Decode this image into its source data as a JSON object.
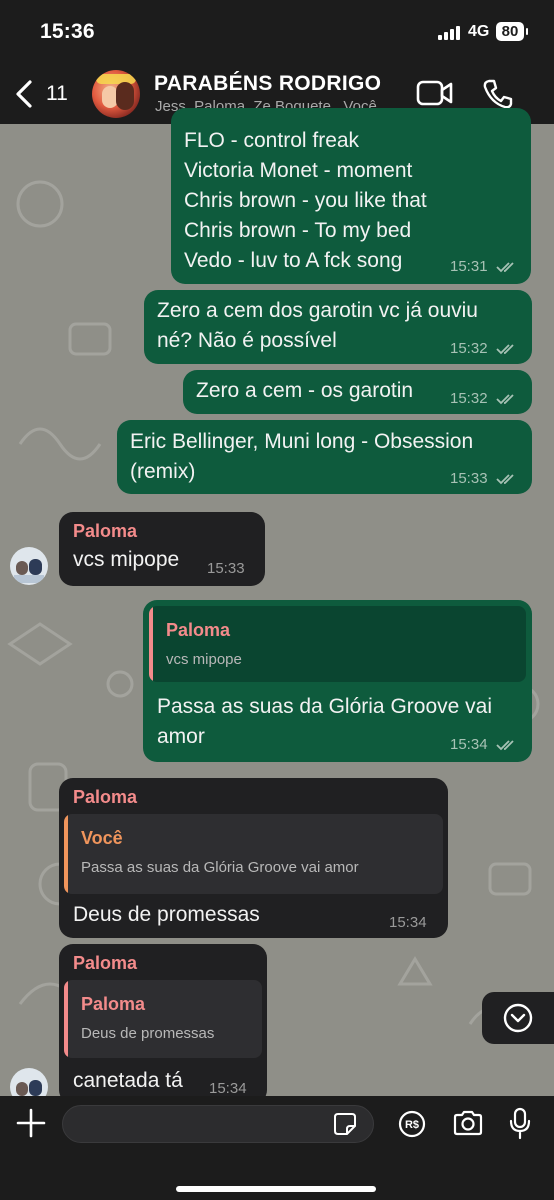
{
  "status": {
    "time": "15:36",
    "network": "4G",
    "battery": "80"
  },
  "header": {
    "back_count": "11",
    "title": "PARABÉNS RODRIGO",
    "participants": "Jess, Paloma, Ze Boquete , Você"
  },
  "messages": [
    {
      "lines": [
        "FLO - control freak",
        "Victoria Monet - moment",
        "Chris brown - you like that",
        "Chris brown - To my bed",
        "Vedo - luv to A fck song"
      ],
      "time": "15:31"
    },
    {
      "lines": [
        "Zero a cem dos garotin vc já ouviu",
        "né? Não é possível"
      ],
      "time": "15:32"
    },
    {
      "lines": [
        "Zero a cem - os garotin"
      ],
      "time": "15:32"
    },
    {
      "lines": [
        "Eric Bellinger, Muni long - Obsession",
        "(remix)"
      ],
      "time": "15:33"
    },
    {
      "sender": "Paloma",
      "lines": [
        "vcs mipope"
      ],
      "time": "15:33"
    },
    {
      "quote_name": "Paloma",
      "quote_text": "vcs mipope",
      "lines": [
        "Passa as suas da Glória Groove vai",
        "amor"
      ],
      "time": "15:34"
    },
    {
      "sender": "Paloma",
      "quote_name": "Você",
      "quote_text": "Passa as suas da Glória Groove vai amor",
      "lines": [
        "Deus de promessas"
      ],
      "time": "15:34"
    },
    {
      "sender": "Paloma",
      "quote_name": "Paloma",
      "quote_text": "Deus de promessas",
      "lines": [
        "canetada tá"
      ],
      "time": "15:34"
    }
  ],
  "colors": {
    "chat_bg": "#8f8f88",
    "outgoing_bubble": "#0e5b3d",
    "incoming_bubble": "#202022",
    "sender_name": "#f38b8b",
    "quote_bar_you": "#f0955c",
    "quote_bar_paloma": "#f38b8b"
  },
  "input": {
    "placeholder": ""
  },
  "icons": [
    "chevron-left-icon",
    "video-call-icon",
    "phone-icon",
    "chevron-down-icon",
    "plus-icon",
    "sticker-icon",
    "payment-icon",
    "camera-icon",
    "microphone-icon"
  ]
}
